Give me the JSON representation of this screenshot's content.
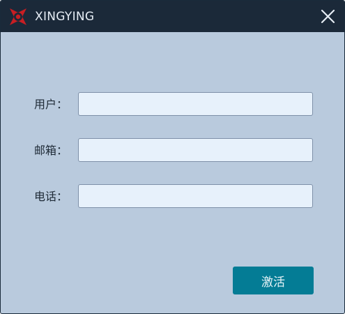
{
  "window": {
    "title": "XINGYING",
    "close_symbol": "×"
  },
  "form": {
    "fields": [
      {
        "label": "用户：",
        "value": "",
        "placeholder": ""
      },
      {
        "label": "邮箱：",
        "value": "",
        "placeholder": ""
      },
      {
        "label": "电话：",
        "value": "",
        "placeholder": ""
      }
    ],
    "submit_label": "激活"
  },
  "icons": {
    "logo": "app-logo-icon",
    "close": "close-icon"
  },
  "colors": {
    "titlebar": "#1b2939",
    "background": "#b9cadd",
    "input_bg": "#e7f1fb",
    "button": "#047c95",
    "logo_red": "#c81e23"
  }
}
